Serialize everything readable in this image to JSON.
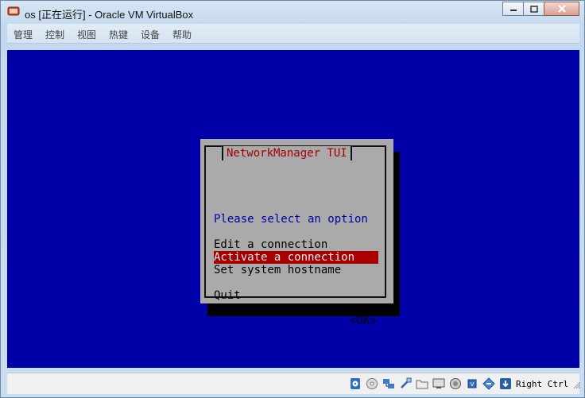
{
  "window": {
    "title": "os [正在运行] - Oracle VM VirtualBox",
    "controls": [
      "minimize-icon",
      "maximize-icon",
      "close-icon"
    ]
  },
  "menu": [
    "管理",
    "控制",
    "视图",
    "热键",
    "设备",
    "帮助"
  ],
  "tui": {
    "title": "NetworkManager TUI",
    "prompt": "Please select an option",
    "options": [
      "Edit a connection",
      "Activate a connection",
      "Set system hostname",
      "Quit"
    ],
    "selected": "Activate a connection",
    "ok_button": "<OK>"
  },
  "statusbar": {
    "icons": [
      "hard-disk-icon",
      "optical-drive-icon",
      "network-icon",
      "usb-icon",
      "shared-folders-icon",
      "display-icon",
      "video-capture-icon",
      "cpu-icon",
      "mouse-integration-icon",
      "keyboard-capture-icon"
    ],
    "host_key": "Right Ctrl"
  },
  "colors": {
    "vm_background": "#0000a8",
    "dialog_background": "#aaaaaa",
    "dialog_title": "#a80000",
    "prompt_text": "#0000a8",
    "selection_background": "#a80000"
  }
}
